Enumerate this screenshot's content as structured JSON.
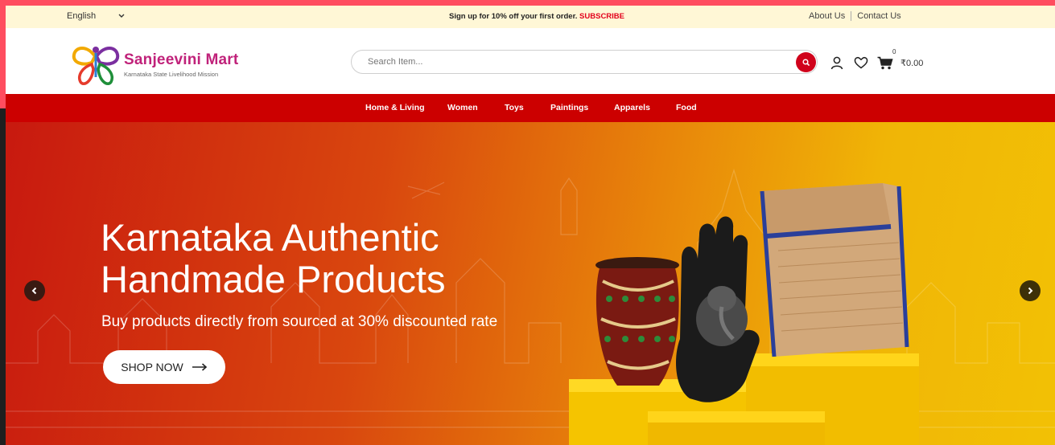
{
  "topbar": {
    "language": "English",
    "promo_text": "Sign up for 10% off your first order.",
    "promo_link": "SUBSCRIBE",
    "links": [
      "About Us",
      "Contact Us"
    ]
  },
  "header": {
    "brand_name": "Sanjeevini Mart",
    "brand_tagline": "Karnataka State Livelihood Mission",
    "search_placeholder": "Search Item...",
    "cart_count": "0",
    "cart_total": "₹0.00"
  },
  "nav": {
    "items": [
      "Home & Living",
      "Women",
      "Toys",
      "Paintings",
      "Apparels",
      "Food"
    ]
  },
  "hero": {
    "title_line1": "Karnataka Authentic",
    "title_line2": "Handmade Products",
    "subtitle": "Buy products directly from sourced at 30% discounted rate",
    "cta_label": "SHOP NOW"
  },
  "colors": {
    "accent_red": "#cc0000",
    "brand_magenta": "#c0227a",
    "promo_bg": "#fff7d6",
    "hero_gradient_start": "#c8190f",
    "hero_gradient_end": "#f2c105"
  },
  "icons": [
    "chevron-down-icon",
    "search-icon",
    "user-icon",
    "heart-icon",
    "cart-icon",
    "arrow-right-icon",
    "chevron-left-icon",
    "chevron-right-icon"
  ]
}
